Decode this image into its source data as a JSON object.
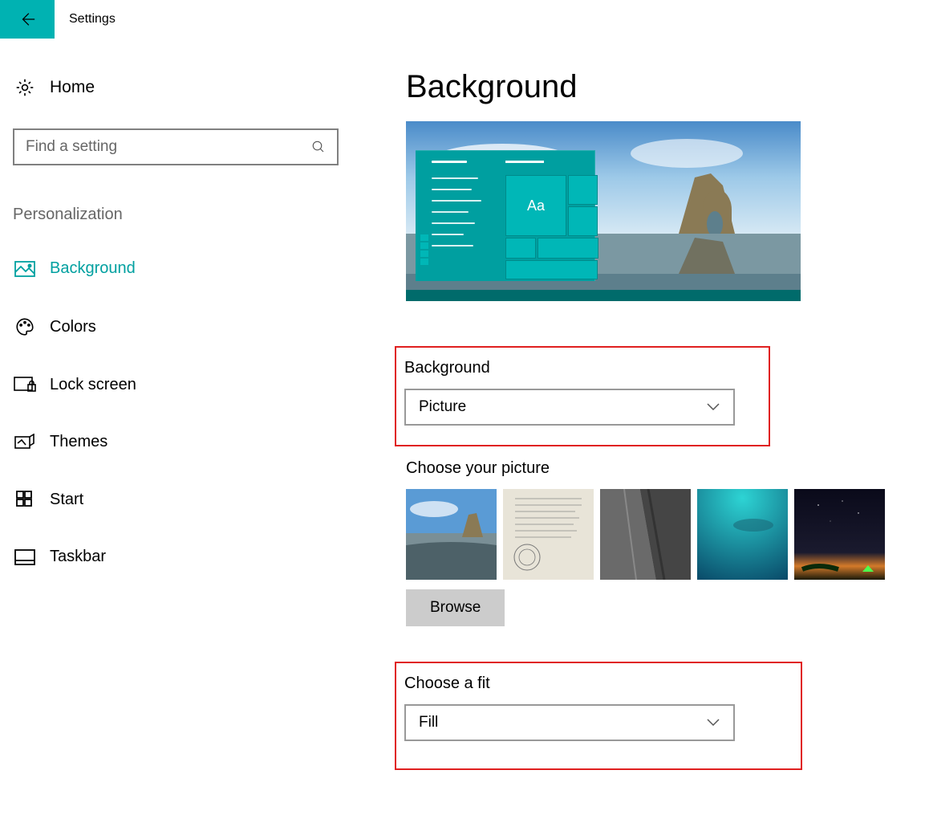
{
  "titlebar": {
    "title": "Settings"
  },
  "sidebar": {
    "home": "Home",
    "search_placeholder": "Find a setting",
    "category": "Personalization",
    "items": [
      {
        "label": "Background",
        "active": true
      },
      {
        "label": "Colors"
      },
      {
        "label": "Lock screen"
      },
      {
        "label": "Themes"
      },
      {
        "label": "Start"
      },
      {
        "label": "Taskbar"
      }
    ]
  },
  "page": {
    "title": "Background",
    "preview_tile_text": "Aa",
    "background_label": "Background",
    "background_value": "Picture",
    "choose_picture_label": "Choose your picture",
    "browse_label": "Browse",
    "fit_label": "Choose a fit",
    "fit_value": "Fill"
  }
}
